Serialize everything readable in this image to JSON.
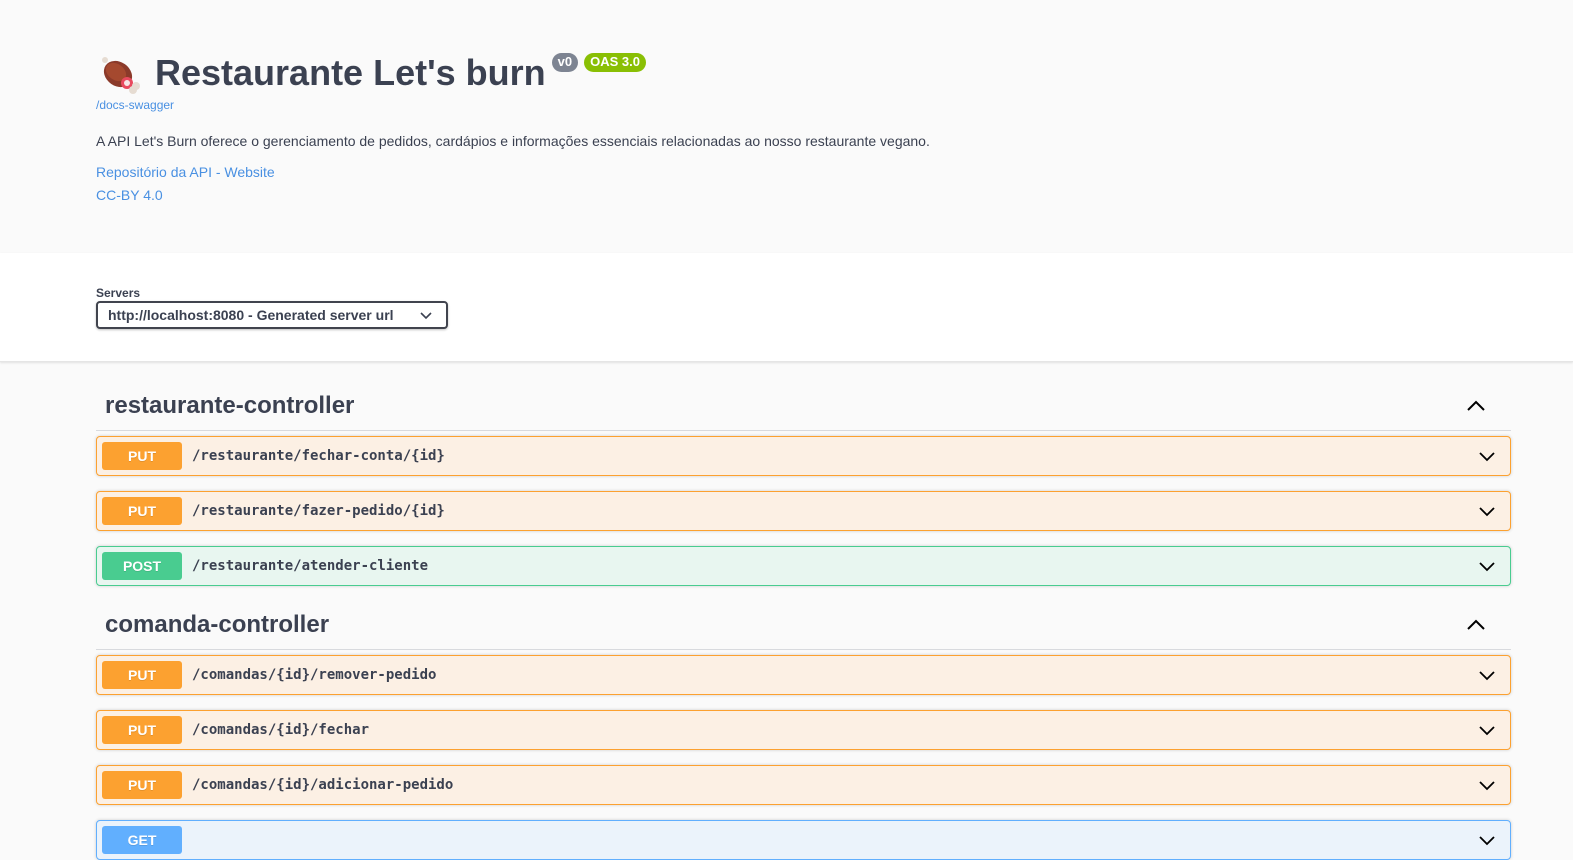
{
  "info": {
    "title": "Restaurante Let's burn",
    "version_badge": "v0",
    "oas_badge": "OAS 3.0",
    "base_url": "/docs-swagger",
    "description": "A API Let's Burn oferece o gerenciamento de pedidos, cardápios e informações essenciais relacionadas ao nosso restaurante vegano.",
    "repo_link": "Repositório da API - Website",
    "license_link": "CC-BY 4.0",
    "logo_icon": "meat-icon"
  },
  "servers": {
    "label": "Servers",
    "selected": "http://localhost:8080 - Generated server url"
  },
  "tags": [
    {
      "name": "restaurante-controller",
      "operations": [
        {
          "method": "PUT",
          "path": "/restaurante/fechar-conta/{id}"
        },
        {
          "method": "PUT",
          "path": "/restaurante/fazer-pedido/{id}"
        },
        {
          "method": "POST",
          "path": "/restaurante/atender-cliente"
        }
      ]
    },
    {
      "name": "comanda-controller",
      "operations": [
        {
          "method": "PUT",
          "path": "/comandas/{id}/remover-pedido"
        },
        {
          "method": "PUT",
          "path": "/comandas/{id}/fechar"
        },
        {
          "method": "PUT",
          "path": "/comandas/{id}/adicionar-pedido"
        },
        {
          "method": "GET",
          "path": ""
        }
      ]
    }
  ],
  "colors": {
    "put": "#fca130",
    "post": "#49cc90",
    "get": "#61affe",
    "link": "#4990e2",
    "text": "#3b4151"
  }
}
